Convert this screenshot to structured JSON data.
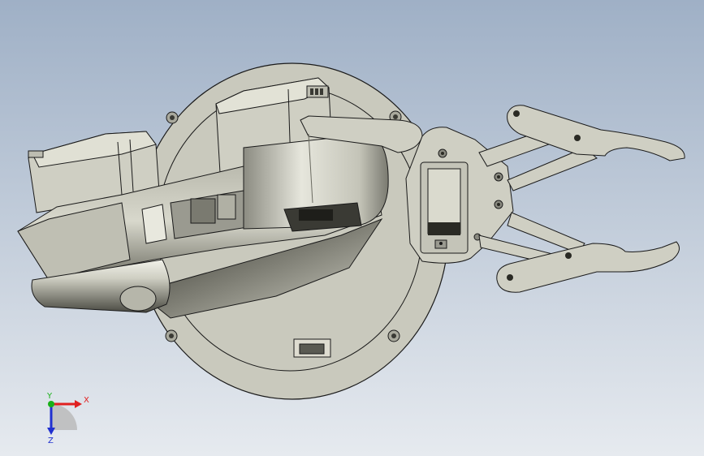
{
  "viewport": {
    "background": {
      "top": "#9fb0c6",
      "bottom": "#e6eaef"
    },
    "part_color": "#c9c9bd",
    "edge_color": "#1a1a1a"
  },
  "model": {
    "components": [
      {
        "name": "base-plate",
        "holes": 4,
        "slots": 1
      },
      {
        "name": "upper-servo"
      },
      {
        "name": "shoulder-servo"
      },
      {
        "name": "upper-arm"
      },
      {
        "name": "elbow-link"
      },
      {
        "name": "wrist-bracket"
      },
      {
        "name": "wrist-servo"
      },
      {
        "name": "gripper-upper-finger"
      },
      {
        "name": "gripper-lower-finger"
      }
    ]
  },
  "triad": {
    "x_label": "X",
    "y_label": "Y",
    "z_label": "Z",
    "x_color": "#e02020",
    "y_color": "#18b018",
    "z_color": "#2030d0"
  }
}
